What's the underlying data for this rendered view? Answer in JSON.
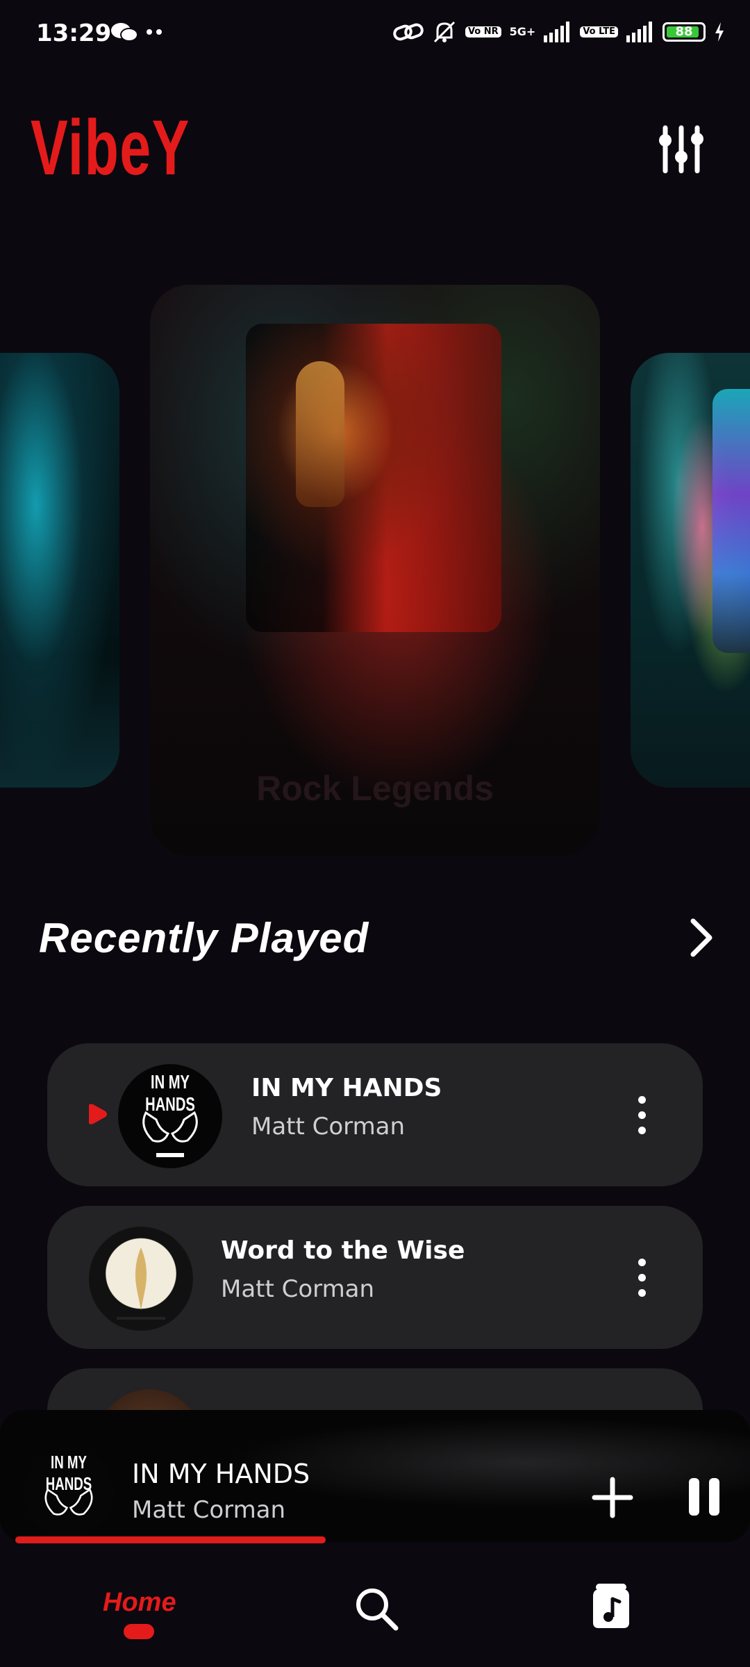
{
  "status_bar": {
    "time": "13:29",
    "network_1": "5G+",
    "chip_vonr": "Vo NR",
    "chip_volte": "Vo LTE",
    "battery_percent": "88"
  },
  "header": {
    "app_name": "VibeY",
    "settings_icon": "sliders-icon"
  },
  "carousel": {
    "cards": [
      {
        "title": ""
      },
      {
        "title": "Rock Legends"
      },
      {
        "title": ""
      }
    ]
  },
  "recently_played": {
    "title": "Recently Played",
    "tracks": [
      {
        "title": "IN MY HANDS",
        "artist": "Matt Corman",
        "cover_text": "IN MY HANDS",
        "playing": true
      },
      {
        "title": "Word to the Wise",
        "artist": "Matt Corman",
        "cover_text": "",
        "playing": false
      },
      {
        "title": "",
        "artist": "",
        "cover_text": "",
        "playing": false
      }
    ]
  },
  "now_playing": {
    "title": "IN MY HANDS",
    "artist": "Matt Corman",
    "cover_text": "IN MY HANDS",
    "progress": 0.43
  },
  "bottom_nav": {
    "home_label": "Home",
    "items": [
      "home",
      "search-icon",
      "library-icon"
    ]
  },
  "colors": {
    "accent": "#e41b1b",
    "background": "#0c080f",
    "card": "#232224"
  }
}
